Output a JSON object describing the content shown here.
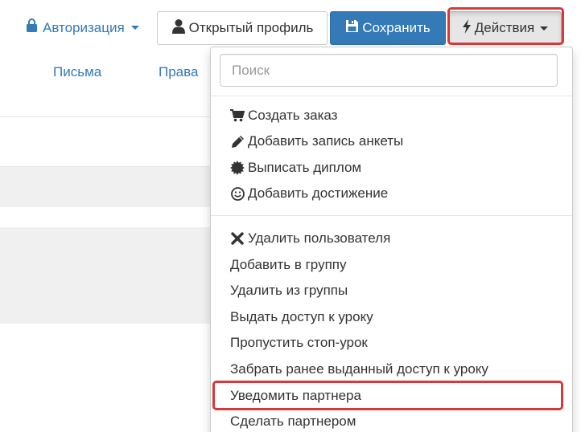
{
  "toolbar": {
    "auth_label": "Авторизация",
    "profile_label": "Открытый профиль",
    "save_label": "Сохранить",
    "actions_label": "Действия"
  },
  "nav": {
    "tabs": [
      {
        "label": "Письма"
      },
      {
        "label": "Права"
      }
    ]
  },
  "dropdown": {
    "search_placeholder": "Поиск",
    "group1": [
      {
        "label": "Создать заказ",
        "icon": "shopping-cart-icon"
      },
      {
        "label": "Добавить запись анкеты",
        "icon": "pencil-icon"
      },
      {
        "label": "Выписать диплом",
        "icon": "certificate-icon"
      },
      {
        "label": "Добавить достижение",
        "icon": "smile-icon"
      }
    ],
    "group2": [
      {
        "label": "Удалить пользователя",
        "icon": "remove-icon"
      },
      {
        "label": "Добавить в группу"
      },
      {
        "label": "Удалить из группы"
      },
      {
        "label": "Выдать доступ к уроку"
      },
      {
        "label": "Пропустить стоп-урок"
      },
      {
        "label": "Забрать ранее выданный доступ к уроку"
      },
      {
        "label": "Уведомить партнера"
      },
      {
        "label": "Сделать партнером"
      }
    ]
  },
  "colors": {
    "link": "#337ab7",
    "primary": "#337ab7",
    "highlight": "#d9383a"
  }
}
